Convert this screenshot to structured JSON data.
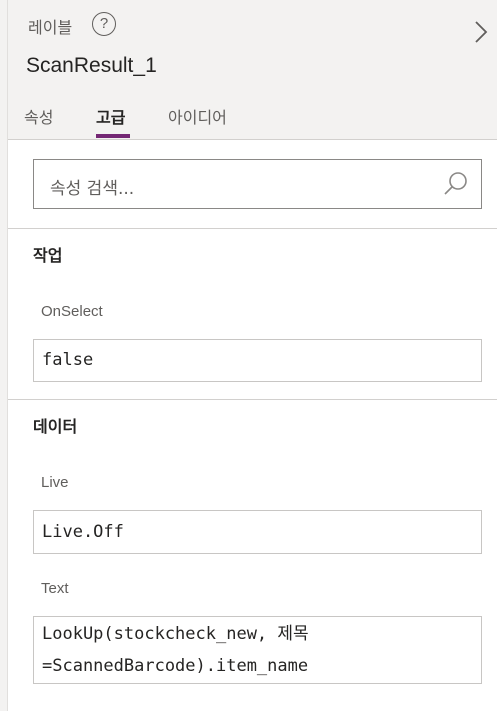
{
  "header": {
    "control_type": "레이블",
    "control_name": "ScanResult_1"
  },
  "icons": {
    "help": "help-icon",
    "expand": "chevron-right-icon",
    "search": "search-icon"
  },
  "tabs": [
    {
      "label": "속성",
      "active": false
    },
    {
      "label": "고급",
      "active": true
    },
    {
      "label": "아이디어",
      "active": false
    }
  ],
  "search": {
    "placeholder": "속성 검색..."
  },
  "sections": {
    "action": {
      "title": "작업",
      "properties": [
        {
          "label": "OnSelect",
          "value": "false"
        }
      ]
    },
    "data": {
      "title": "데이터",
      "properties": [
        {
          "label": "Live",
          "value": "Live.Off"
        },
        {
          "label": "Text",
          "value": "LookUp(stockcheck_new, 제목\n=ScannedBarcode).item_name"
        }
      ]
    }
  },
  "colors": {
    "accent": "#742774",
    "header_bg": "#f3f2f1"
  }
}
